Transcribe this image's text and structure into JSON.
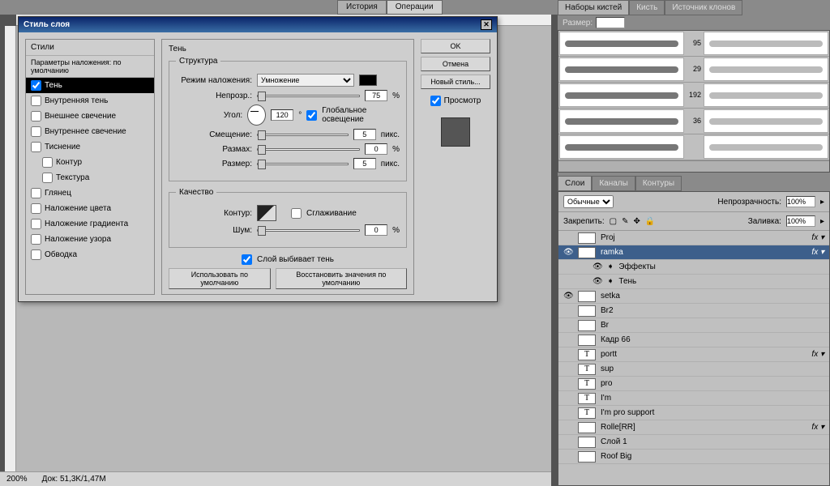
{
  "top_tabs": {
    "history": "История",
    "operations": "Операции"
  },
  "status": {
    "zoom": "200%",
    "doc": "Док: 51,3K/1,47M"
  },
  "dialog": {
    "title": "Стиль слоя",
    "close": "✕",
    "styles_header": "Стили",
    "styles_sub": "Параметры наложения: по умолчанию",
    "items": [
      {
        "label": "Тень",
        "checked": true,
        "selected": true
      },
      {
        "label": "Внутренняя тень"
      },
      {
        "label": "Внешнее свечение"
      },
      {
        "label": "Внутреннее свечение"
      },
      {
        "label": "Тиснение"
      },
      {
        "label": "Контур",
        "indent": true
      },
      {
        "label": "Текстура",
        "indent": true
      },
      {
        "label": "Глянец"
      },
      {
        "label": "Наложение цвета"
      },
      {
        "label": "Наложение градиента"
      },
      {
        "label": "Наложение узора"
      },
      {
        "label": "Обводка"
      }
    ],
    "options": {
      "section_title": "Тень",
      "structure": "Структура",
      "blend_label": "Режим наложения:",
      "blend_value": "Умножение",
      "opacity_label": "Непрозр.:",
      "opacity_value": "75",
      "pct": "%",
      "angle_label": "Угол:",
      "angle_value": "120",
      "deg": "°",
      "global_light": "Глобальное освещение",
      "distance_label": "Смещение:",
      "distance_value": "5",
      "px": "пикс.",
      "spread_label": "Размах:",
      "spread_value": "0",
      "size_label": "Размер:",
      "size_value": "5",
      "quality": "Качество",
      "contour_label": "Контур:",
      "antialias": "Сглаживание",
      "noise_label": "Шум:",
      "noise_value": "0",
      "knock_out": "Слой выбивает тень",
      "use_default": "Использовать по умолчанию",
      "reset_default": "Восстановить значения по умолчанию"
    },
    "ok": "OK",
    "cancel": "Отмена",
    "new_style": "Новый стиль...",
    "preview": "Просмотр"
  },
  "right": {
    "brush_tabs": {
      "sets": "Наборы кистей",
      "brush": "Кисть",
      "clone": "Источник клонов"
    },
    "size_label": "Размер:",
    "brush_sizes": [
      "",
      "95",
      "29",
      "192",
      "36",
      ""
    ],
    "layers_tabs": {
      "layers": "Слои",
      "channels": "Каналы",
      "paths": "Контуры"
    },
    "mode": "Обычные",
    "opacity_label": "Непрозрачность:",
    "opacity_value": "100%",
    "lock_label": "Закрепить:",
    "fill_label": "Заливка:",
    "fill_value": "100%",
    "layers": [
      {
        "name": "Proj",
        "fx": true
      },
      {
        "name": "ramka",
        "fx": true,
        "selected": true,
        "eye": true
      },
      {
        "name": "Эффекты",
        "sub": true,
        "eye": true
      },
      {
        "name": "Тень",
        "sub": true,
        "eye": true
      },
      {
        "name": "setka",
        "eye": true
      },
      {
        "name": "Br2"
      },
      {
        "name": "Br"
      },
      {
        "name": "Кадр 66"
      },
      {
        "name": "portt",
        "type": "T",
        "fx": true
      },
      {
        "name": "sup",
        "type": "T"
      },
      {
        "name": "pro",
        "type": "T"
      },
      {
        "name": "I'm",
        "type": "T"
      },
      {
        "name": "I'm pro support",
        "type": "T"
      },
      {
        "name": "Rolle[RR]",
        "fx": true
      },
      {
        "name": "Слой 1"
      },
      {
        "name": "Roof Big"
      }
    ]
  }
}
